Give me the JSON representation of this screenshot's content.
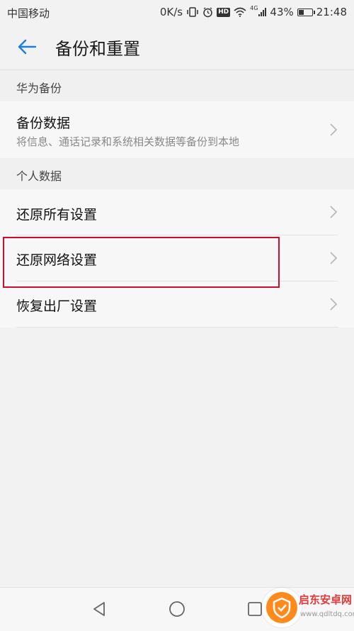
{
  "status_bar": {
    "carrier": "中国移动",
    "speed": "0K/s",
    "hd": "HD",
    "network": "4G",
    "battery_percent": "43%",
    "battery_level": 0.43,
    "time": "21:48"
  },
  "header": {
    "title": "备份和重置",
    "accent_color": "#1a7fe0"
  },
  "sections": [
    {
      "title": "华为备份",
      "items": [
        {
          "title": "备份数据",
          "subtitle": "将信息、通话记录和系统相关数据等备份到本地"
        }
      ]
    },
    {
      "title": "个人数据",
      "items": [
        {
          "title": "还原所有设置"
        },
        {
          "title": "还原网络设置",
          "highlighted": true
        },
        {
          "title": "恢复出厂设置"
        }
      ]
    }
  ],
  "highlight_color": "#c8102e",
  "watermark": {
    "name": "启东安卓网",
    "url": "www.qdltdq.com"
  }
}
